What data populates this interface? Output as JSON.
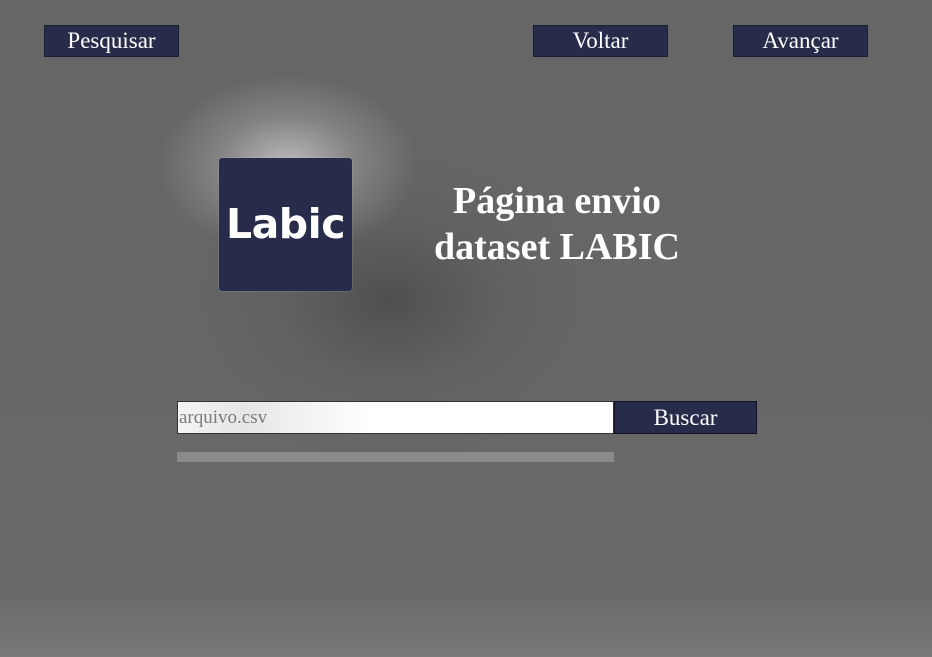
{
  "nav": {
    "search_label": "Pesquisar",
    "back_label": "Voltar",
    "forward_label": "Avançar"
  },
  "logo": {
    "text": "Labic"
  },
  "header": {
    "title": "Página envio dataset LABIC"
  },
  "upload": {
    "placeholder": "arquivo.csv",
    "value": "",
    "fetch_label": "Buscar",
    "progress": 0
  },
  "colors": {
    "background": "#666666",
    "button": "#272c4b",
    "button_text": "#ffffff",
    "progress_track": "#8a8a8a"
  }
}
